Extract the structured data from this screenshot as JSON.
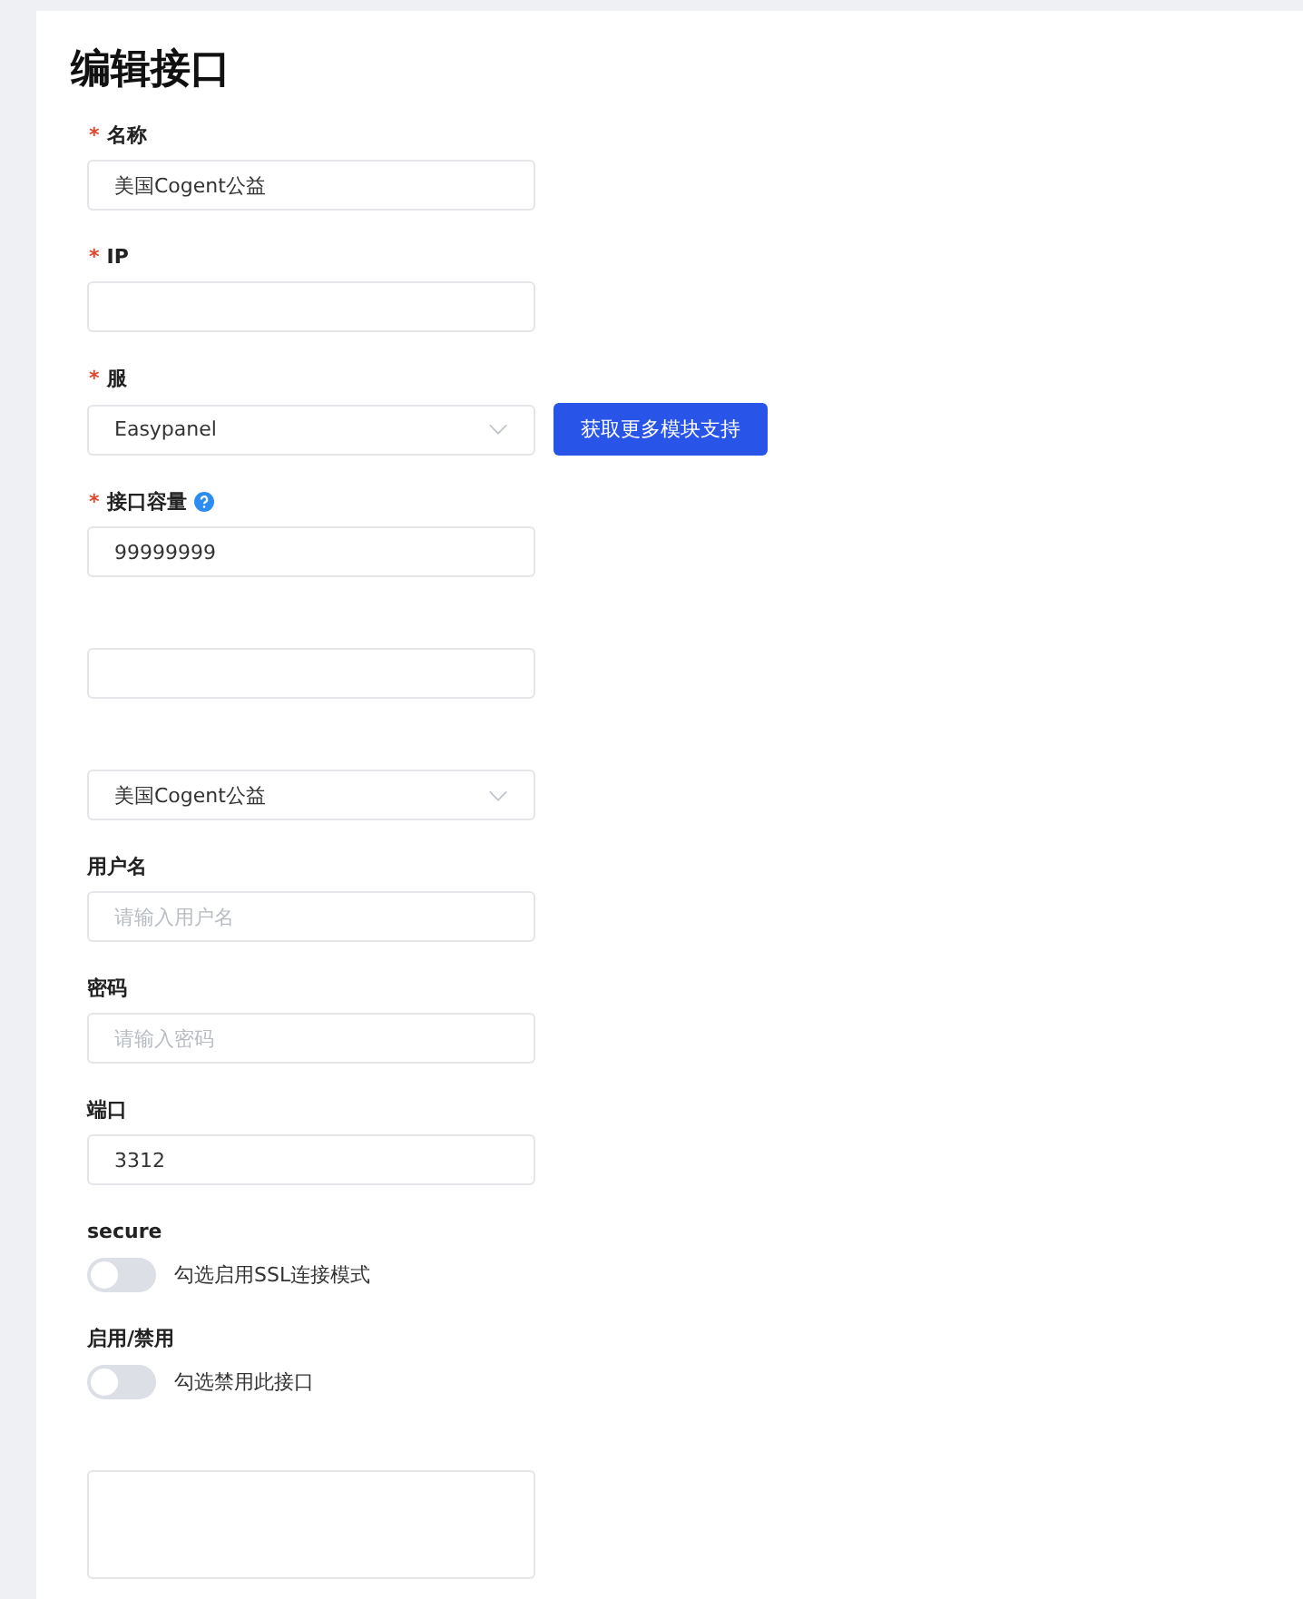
{
  "title": "编辑接口",
  "fields": [
    {
      "kind": "input",
      "required_mark": "*",
      "label": "名称",
      "value": "美国Cogent公益"
    },
    {
      "kind": "input",
      "required_mark": "*",
      "label": "IP"
    },
    {
      "kind": "select",
      "required_mark": "*",
      "label": "服",
      "value": "Easypanel",
      "button": "获取更多模块支持"
    },
    {
      "kind": "input",
      "required_mark": "*",
      "label": "接口容量",
      "help": true,
      "value": "99999999"
    },
    {
      "kind": "input"
    },
    {
      "kind": "select",
      "value": "美国Cogent公益"
    },
    {
      "kind": "input",
      "label": "用户名",
      "placeholder": "请输入用户名"
    },
    {
      "kind": "input",
      "label": "密码",
      "placeholder": "请输入密码"
    },
    {
      "kind": "input",
      "label": "端口",
      "value": "3312"
    },
    {
      "kind": "switch",
      "label": "secure",
      "on": false,
      "text": "勾选启用SSL连接模式"
    },
    {
      "kind": "switch",
      "label": "启用/禁用",
      "on": false,
      "text": "勾选禁用此接口"
    },
    {
      "kind": "textarea"
    }
  ]
}
